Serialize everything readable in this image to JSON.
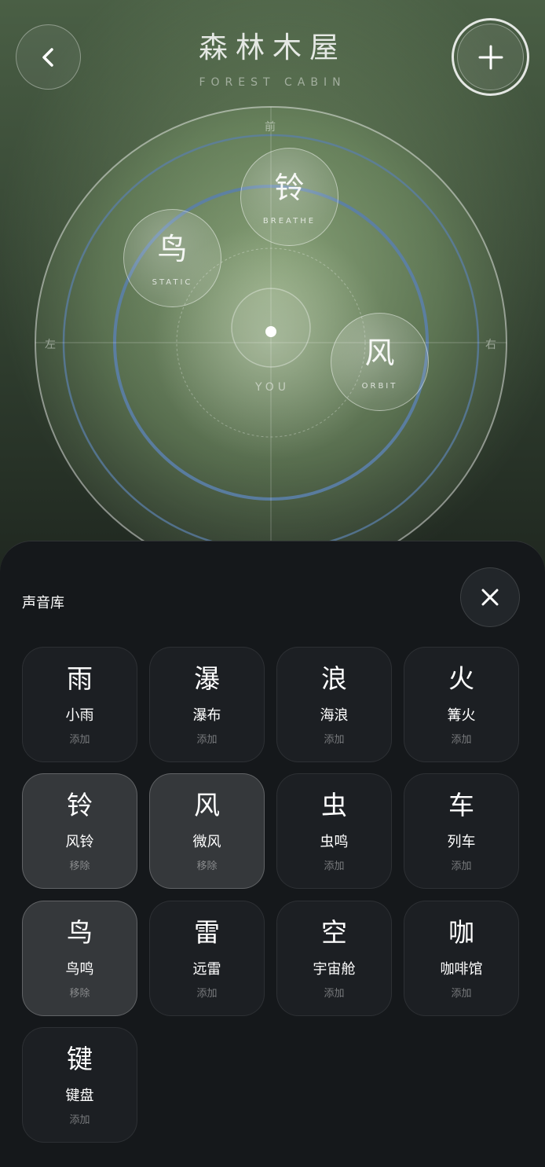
{
  "header": {
    "title": "森林木屋",
    "subtitle": "FOREST CABIN",
    "back_icon": "chevron-left-icon",
    "add_icon": "plus-icon"
  },
  "stage": {
    "front_label": "前",
    "left_label": "左",
    "right_label": "右",
    "listener_label": "YOU",
    "sources": [
      {
        "glyph": "铃",
        "mode": "BREATHE"
      },
      {
        "glyph": "鸟",
        "mode": "STATIC"
      },
      {
        "glyph": "风",
        "mode": "ORBIT"
      }
    ]
  },
  "library": {
    "title": "声音库",
    "close_icon": "close-icon",
    "items": [
      {
        "glyph": "雨",
        "name": "小雨",
        "action": "添加",
        "active": false
      },
      {
        "glyph": "瀑",
        "name": "瀑布",
        "action": "添加",
        "active": false
      },
      {
        "glyph": "浪",
        "name": "海浪",
        "action": "添加",
        "active": false
      },
      {
        "glyph": "火",
        "name": "篝火",
        "action": "添加",
        "active": false
      },
      {
        "glyph": "铃",
        "name": "风铃",
        "action": "移除",
        "active": true
      },
      {
        "glyph": "风",
        "name": "微风",
        "action": "移除",
        "active": true
      },
      {
        "glyph": "虫",
        "name": "虫鸣",
        "action": "添加",
        "active": false
      },
      {
        "glyph": "车",
        "name": "列车",
        "action": "添加",
        "active": false
      },
      {
        "glyph": "鸟",
        "name": "鸟鸣",
        "action": "移除",
        "active": true
      },
      {
        "glyph": "雷",
        "name": "远雷",
        "action": "添加",
        "active": false
      },
      {
        "glyph": "空",
        "name": "宇宙舱",
        "action": "添加",
        "active": false
      },
      {
        "glyph": "咖",
        "name": "咖啡馆",
        "action": "添加",
        "active": false
      },
      {
        "glyph": "键",
        "name": "键盘",
        "action": "添加",
        "active": false
      }
    ]
  },
  "colors": {
    "ring_blue": "#5b7fa8",
    "sheet_bg": "#15181b",
    "tile_bg": "#1c1f23",
    "tile_active_bg": "#35383b"
  }
}
